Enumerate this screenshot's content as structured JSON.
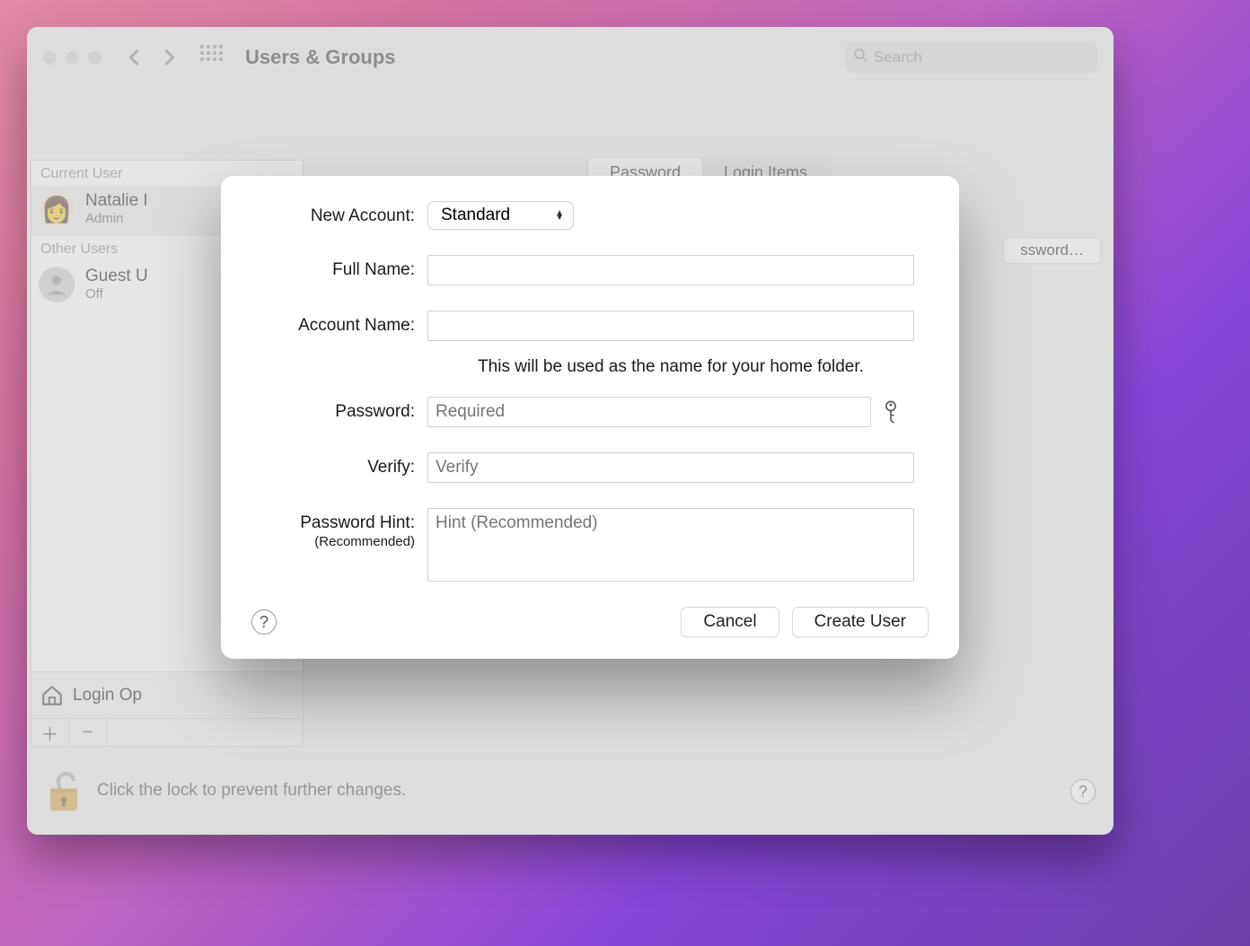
{
  "window": {
    "title": "Users & Groups",
    "search_placeholder": "Search"
  },
  "tabs": {
    "password": "Password",
    "login_items": "Login Items"
  },
  "sidebar": {
    "current_header": "Current User",
    "current_user": {
      "name": "Natalie I",
      "role": "Admin"
    },
    "other_header": "Other Users",
    "guest": {
      "name": "Guest U",
      "role": "Off"
    },
    "login_options": "Login Op"
  },
  "content": {
    "change_password": "ssword…"
  },
  "footer": {
    "lock_text": "Click the lock to prevent further changes."
  },
  "modal": {
    "labels": {
      "new_account": "New Account:",
      "full_name": "Full Name:",
      "account_name": "Account Name:",
      "password": "Password:",
      "verify": "Verify:",
      "hint": "Password Hint:",
      "hint_sub": "(Recommended)"
    },
    "new_account_type": "Standard",
    "full_name": "",
    "account_name": "",
    "account_name_hint": "This will be used as the name for your home folder.",
    "password_placeholder": "Required",
    "verify_placeholder": "Verify",
    "hint_placeholder": "Hint (Recommended)",
    "cancel": "Cancel",
    "create": "Create User"
  }
}
